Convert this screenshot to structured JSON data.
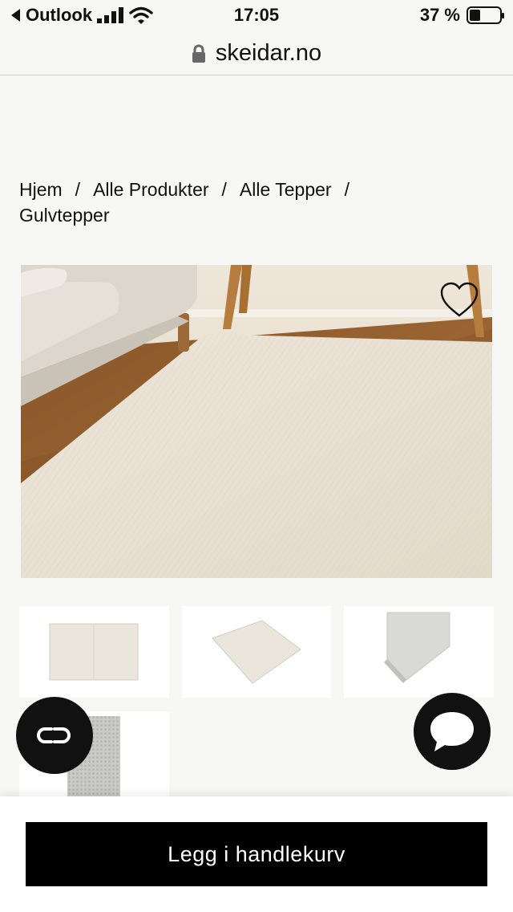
{
  "status_bar": {
    "back_app": "Outlook",
    "time": "17:05",
    "battery_percent": "37 %",
    "battery_level": 0.37
  },
  "browser": {
    "domain": "skeidar.no"
  },
  "breadcrumb": {
    "items": [
      "Hjem",
      "Alle Produkter",
      "Alle Tepper",
      "Gulvtepper"
    ],
    "separator": "/"
  },
  "product": {
    "gallery": {
      "favorite_icon": "heart-outline-icon",
      "thumbnail_count": 4
    }
  },
  "floating_buttons": {
    "left_icon": "co-logo-icon",
    "right_icon": "chat-bubble-icon"
  },
  "bottom_bar": {
    "add_to_cart_label": "Legg i handlekurv"
  },
  "colors": {
    "page_background": "#f7f7f5",
    "button_background": "#000000",
    "button_text": "#ffffff"
  }
}
